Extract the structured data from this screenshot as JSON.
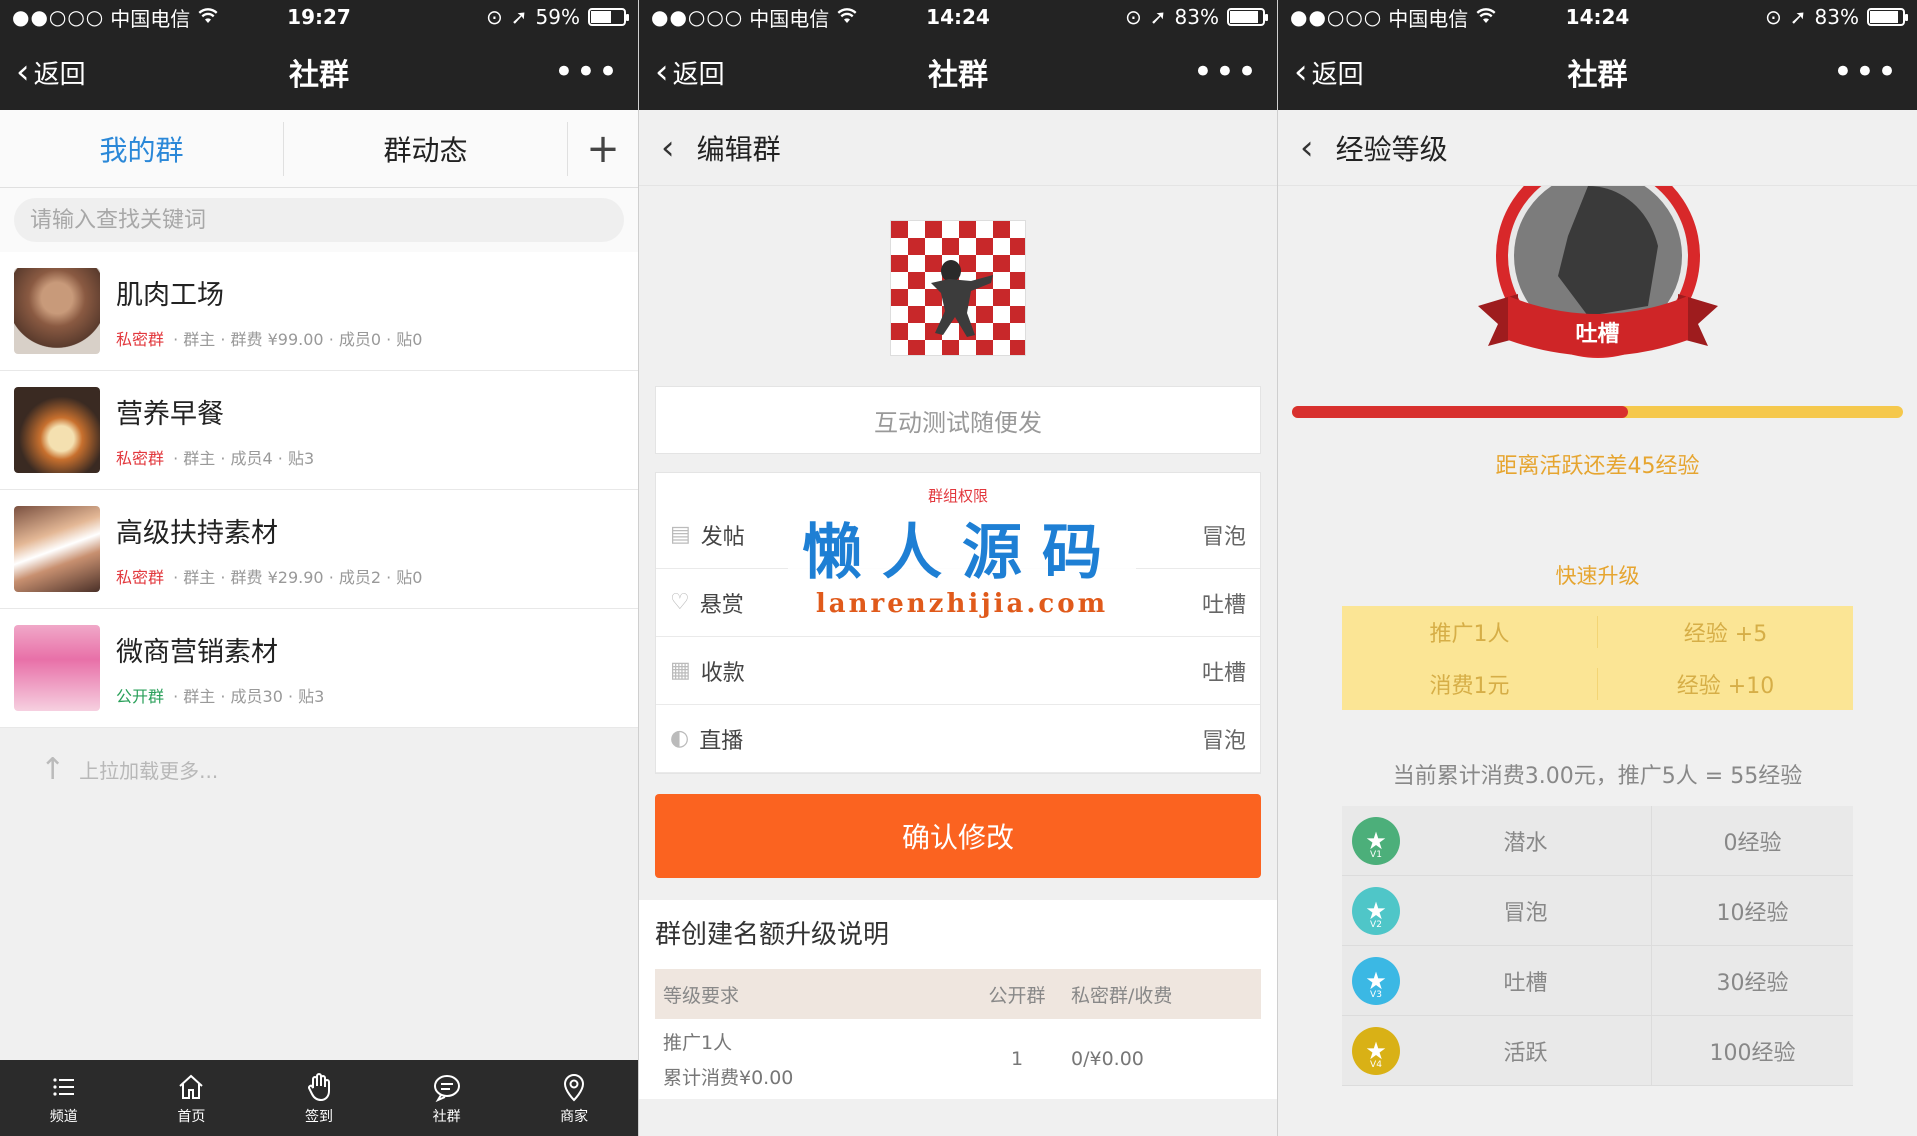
{
  "screens": [
    {
      "status": {
        "signal": "●●○○○",
        "carrier": "中国电信",
        "time": "19:27",
        "battery": "59%",
        "battery_level": 0.59
      },
      "nav": {
        "back": "返回",
        "title": "社群",
        "more": "•••"
      }
    },
    {
      "status": {
        "signal": "●●○○○",
        "carrier": "中国电信",
        "time": "14:24",
        "battery": "83%",
        "battery_level": 0.83
      },
      "nav": {
        "back": "返回",
        "title": "社群",
        "more": "•••"
      }
    },
    {
      "status": {
        "signal": "●●○○○",
        "carrier": "中国电信",
        "time": "14:24",
        "battery": "83%",
        "battery_level": 0.83
      },
      "nav": {
        "back": "返回",
        "title": "社群",
        "more": "•••"
      }
    }
  ],
  "groups_screen": {
    "tabs": [
      "我的群",
      "群动态"
    ],
    "plus": "+",
    "search_placeholder": "请输入查找关键词",
    "groups": [
      {
        "name": "肌肉工场",
        "type": "私密群",
        "type_kind": "private",
        "meta": " · 群主 · 群费 ¥99.00 · 成员0 · 贴0"
      },
      {
        "name": "营养早餐",
        "type": "私密群",
        "type_kind": "private",
        "meta": " · 群主 · 成员4 · 贴3"
      },
      {
        "name": "高级扶持素材",
        "type": "私密群",
        "type_kind": "private",
        "meta": " · 群主 · 群费 ¥29.90 · 成员2 · 贴0"
      },
      {
        "name": "微商营销素材",
        "type": "公开群",
        "type_kind": "public",
        "meta": " · 群主 · 成员30 · 贴3"
      }
    ],
    "load_more": "上拉加载更多...",
    "tabbar": [
      "频道",
      "首页",
      "签到",
      "社群",
      "商家"
    ]
  },
  "edit_screen": {
    "heading": "编辑群",
    "description": "互动测试随便发",
    "perm_title": "群组权限",
    "logo_cn": "懒人源码",
    "logo_en": "lanrenzhijia.com",
    "perms": [
      {
        "label": "发帖",
        "value": "冒泡"
      },
      {
        "label": "悬赏",
        "value": "吐槽"
      },
      {
        "label": "收款",
        "value": "吐槽"
      },
      {
        "label": "直播",
        "value": "冒泡"
      }
    ],
    "confirm": "确认修改",
    "rule_title": "群创建名额升级说明",
    "rule_head": [
      "等级要求",
      "公开群",
      "私密群/收费"
    ],
    "rule_rows": [
      {
        "req1": "推广1人",
        "req2": "累计消费¥0.00",
        "public": "1",
        "private": "0/¥0.00"
      }
    ]
  },
  "level_screen": {
    "heading": "经验等级",
    "badge_label": "吐槽",
    "progress": 0.55,
    "remain": "距离活跃还差45经验",
    "quick_title": "快速升级",
    "quick": [
      {
        "left": "推广1人",
        "right": "经验 +5"
      },
      {
        "left": "消费1元",
        "right": "经验 +10"
      }
    ],
    "total": "当前累计消费3.00元，推广5人 = 55经验",
    "levels": [
      {
        "name": "潜水",
        "exp": "0经验",
        "tag": "V1",
        "color": "#4caf7a"
      },
      {
        "name": "冒泡",
        "exp": "10经验",
        "tag": "V2",
        "color": "#4fc6c8"
      },
      {
        "name": "吐槽",
        "exp": "30经验",
        "tag": "V3",
        "color": "#3bb8e4"
      },
      {
        "name": "活跃",
        "exp": "100经验",
        "tag": "V4",
        "color": "#d9b116"
      }
    ]
  }
}
